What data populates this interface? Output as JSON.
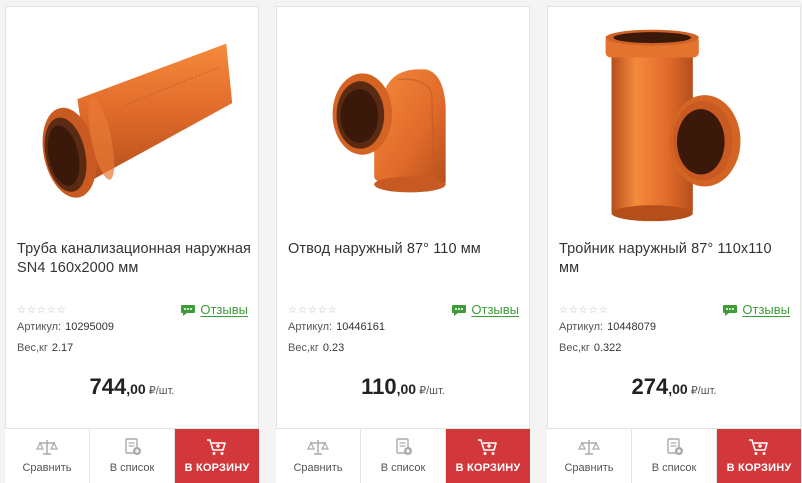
{
  "products": [
    {
      "title": "Труба канализационная наружная SN4 160х2000 мм",
      "stars": "☆☆☆☆☆",
      "reviews_label": "Отзывы",
      "sku_label": "Артикул:",
      "sku": "10295009",
      "weight_label": "Вес,кг",
      "weight": "2.17",
      "price_int": "744",
      "price_dec": ",00",
      "price_unit": "₽/шт.",
      "compare_label": "Сравнить",
      "list_label": "В список",
      "cart_label": "В КОРЗИНУ"
    },
    {
      "title": "Отвод наружный 87° 110 мм",
      "stars": "☆☆☆☆☆",
      "reviews_label": "Отзывы",
      "sku_label": "Артикул:",
      "sku": "10446161",
      "weight_label": "Вес,кг",
      "weight": "0.23",
      "price_int": "110",
      "price_dec": ",00",
      "price_unit": "₽/шт.",
      "compare_label": "Сравнить",
      "list_label": "В список",
      "cart_label": "В КОРЗИНУ"
    },
    {
      "title": "Тройник наружный 87° 110х110 мм",
      "stars": "☆☆☆☆☆",
      "reviews_label": "Отзывы",
      "sku_label": "Артикул:",
      "sku": "10448079",
      "weight_label": "Вес,кг",
      "weight": "0.322",
      "price_int": "274",
      "price_dec": ",00",
      "price_unit": "₽/шт.",
      "compare_label": "Сравнить",
      "list_label": "В список",
      "cart_label": "В КОРЗИНУ"
    }
  ],
  "colors": {
    "pipe_orange": "#e06a2a",
    "cart_red": "#d2373c",
    "reviews_green": "#3e9b3a"
  },
  "icons": {
    "reviews": "speech-bubble-icon",
    "compare": "scales-icon",
    "list": "list-add-icon",
    "cart": "cart-icon"
  }
}
